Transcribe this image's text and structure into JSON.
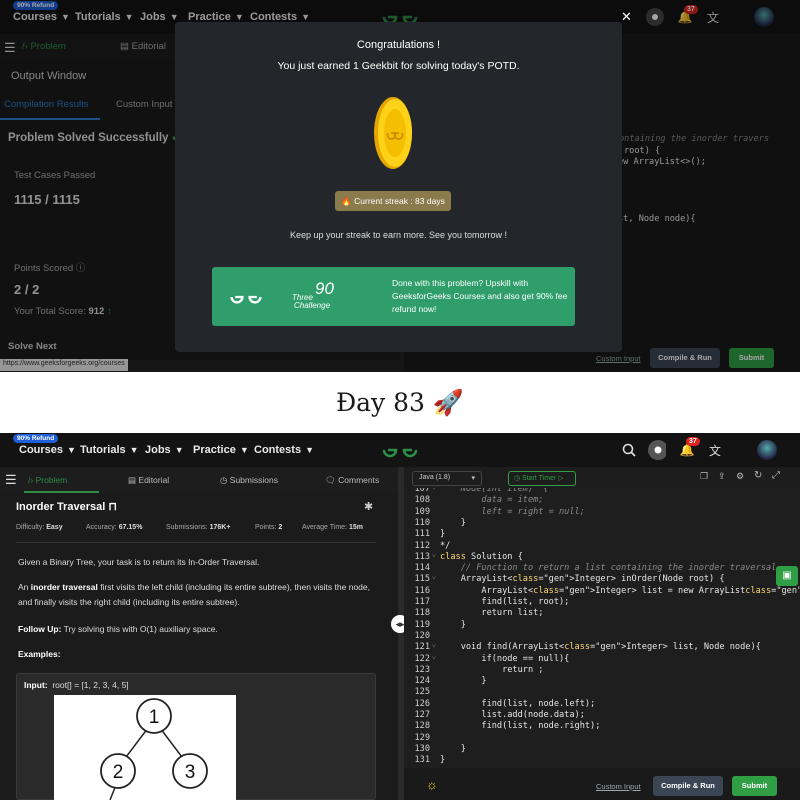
{
  "nav": {
    "refund_badge": "90% Refund",
    "items": [
      "Courses",
      "Tutorials",
      "Jobs",
      "Practice",
      "Contests"
    ],
    "notif_count": "37"
  },
  "top": {
    "tabs": {
      "problem": "Problem",
      "editorial": "Editorial"
    },
    "output_window": "Output Window",
    "compilation_results": "Compilation Results",
    "custom_input": "Custom Input",
    "problem_solved": "Problem Solved Successfully",
    "test_cases_label": "Test Cases Passed",
    "test_cases_value": "1115 / 1115",
    "points_label": "Points Scored",
    "points_value": "2 / 2",
    "total_score_label": "Your Total Score:",
    "total_score_value": "912",
    "solve_next": "Solve Next",
    "status_url": "https://www.geeksforgeeks.org/courses",
    "bg_code": [
      "ontaining the inorder travers",
      "root) {",
      "ew ArrayList<>();",
      "st, Node node){"
    ],
    "custom_input_link": "Custom Input",
    "compile_run": "Compile & Run",
    "submit": "Submit"
  },
  "modal": {
    "title": "Congratulations !",
    "subtitle": "You just earned 1 Geekbit for solving today's POTD.",
    "streak": "Current streak : 83 days",
    "keep": "Keep up your streak to earn more. See you tomorrow !",
    "promo_text": "Done with this problem? Upskill with GeeksforGeeks Courses and also get 90% fee refund now!",
    "promo_three": "Three",
    "promo_ninety": "90",
    "promo_challenge": "Challenge"
  },
  "caption": "Đay 83 🚀",
  "bottom": {
    "tabs": {
      "problem": "Problem",
      "editorial": "Editorial",
      "submissions": "Submissions",
      "comments": "Comments"
    },
    "language": "Java (1.8)",
    "start_timer": "Start Timer",
    "problem_title": "Inorder Traversal",
    "difficulty_label": "Difficulty:",
    "difficulty_value": "Easy",
    "accuracy_label": "Accuracy:",
    "accuracy_value": "67.15%",
    "submissions_label": "Submissions:",
    "submissions_value": "176K+",
    "points_label": "Points:",
    "points_value": "2",
    "avg_time_label": "Average Time:",
    "avg_time_value": "15m",
    "desc1": "Given a Binary Tree, your task is to return its In-Order Traversal.",
    "desc2_pre": "An ",
    "desc2_bold": "inorder traversal",
    "desc2_post": " first visits the left child (including its entire subtree), then visits the node, and finally visits the right child (including its entire subtree).",
    "followup_bold": "Follow Up:",
    "followup_text": " Try solving this with O(1) auxiliary space.",
    "examples": "Examples:",
    "input_label": "Input:",
    "input_value": "root[] = [1, 2, 3, 4, 5]",
    "tree_nodes": [
      "1",
      "2",
      "3"
    ],
    "custom_input_link": "Custom Input",
    "compile_run": "Compile & Run",
    "submit": "Submit",
    "code": [
      {
        "n": "107",
        "f": "-",
        "t": "    Node(int item)  {"
      },
      {
        "n": "108",
        "f": "",
        "t": "        data = item;"
      },
      {
        "n": "109",
        "f": "",
        "t": "        left = right = null;"
      },
      {
        "n": "110",
        "f": "",
        "t": "    }"
      },
      {
        "n": "111",
        "f": "",
        "t": "}"
      },
      {
        "n": "112",
        "f": "",
        "t": "*/"
      },
      {
        "n": "113",
        "f": "-",
        "t": "class Solution {"
      },
      {
        "n": "114",
        "f": "",
        "t": "    // Function to return a list containing the inorder traversal"
      },
      {
        "n": "115",
        "f": "-",
        "t": "    ArrayList<Integer> inOrder(Node root) {"
      },
      {
        "n": "116",
        "f": "",
        "t": "        ArrayList<Integer> list = new ArrayList<>();"
      },
      {
        "n": "117",
        "f": "",
        "t": "        find(list, root);"
      },
      {
        "n": "118",
        "f": "",
        "t": "        return list;"
      },
      {
        "n": "119",
        "f": "",
        "t": "    }"
      },
      {
        "n": "120",
        "f": "",
        "t": ""
      },
      {
        "n": "121",
        "f": "-",
        "t": "    void find(ArrayList<Integer> list, Node node){"
      },
      {
        "n": "122",
        "f": "-",
        "t": "        if(node == null){"
      },
      {
        "n": "123",
        "f": "",
        "t": "            return ;"
      },
      {
        "n": "124",
        "f": "",
        "t": "        }"
      },
      {
        "n": "125",
        "f": "",
        "t": ""
      },
      {
        "n": "126",
        "f": "",
        "t": "        find(list, node.left);"
      },
      {
        "n": "127",
        "f": "",
        "t": "        list.add(node.data);"
      },
      {
        "n": "128",
        "f": "",
        "t": "        find(list, node.right);"
      },
      {
        "n": "129",
        "f": "",
        "t": ""
      },
      {
        "n": "130",
        "f": "",
        "t": "    }"
      },
      {
        "n": "131",
        "f": "",
        "t": "}"
      }
    ]
  },
  "colors": {
    "accent_green": "#2f9e44",
    "brand_green": "#2f8d46",
    "tab_active": "#2c8c46"
  }
}
